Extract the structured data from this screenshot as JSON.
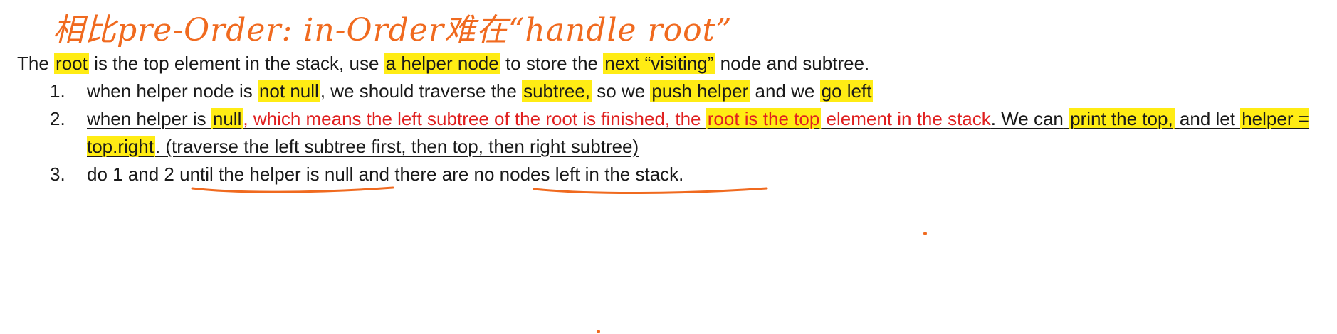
{
  "handwritten_title": "相比pre-Order: in-Order难在“handle root”",
  "intro": {
    "p1": "The",
    "root": "root",
    "p2": "is the top element in the stack, use",
    "helper_node": "a helper node",
    "p3": "to store the",
    "next_visiting": "next “visiting”",
    "p4": "node and subtree."
  },
  "steps": [
    {
      "num": "1.",
      "p1": "when helper node is",
      "not_null": "not null",
      "p2": ", we should traverse the",
      "subtree": "subtree,",
      "p3": "so we",
      "push_helper": "push helper",
      "p4": "and we",
      "go_left": "go left"
    },
    {
      "num": "2.",
      "p1": "when helper is",
      "null": "null",
      "red1": ", which means the left subtree of the root is finished, the",
      "root_top": "root is the top",
      "red2": "element in the stack",
      "p2": ". We can",
      "print_top": "print the top,",
      "p3": "and let",
      "helper_assign": "helper = top.right",
      "p4": ". (traverse the left subtree first, then top, then right subtree)"
    },
    {
      "num": "3.",
      "p1": "do 1 and 2",
      "until_null": "until the helper is null",
      "p2": "and there are",
      "no_nodes": "no nodes left in the stack."
    }
  ],
  "colors": {
    "highlight": "#ffea00",
    "annotation_ink": "#f06a1f",
    "red_text": "#e02020"
  }
}
